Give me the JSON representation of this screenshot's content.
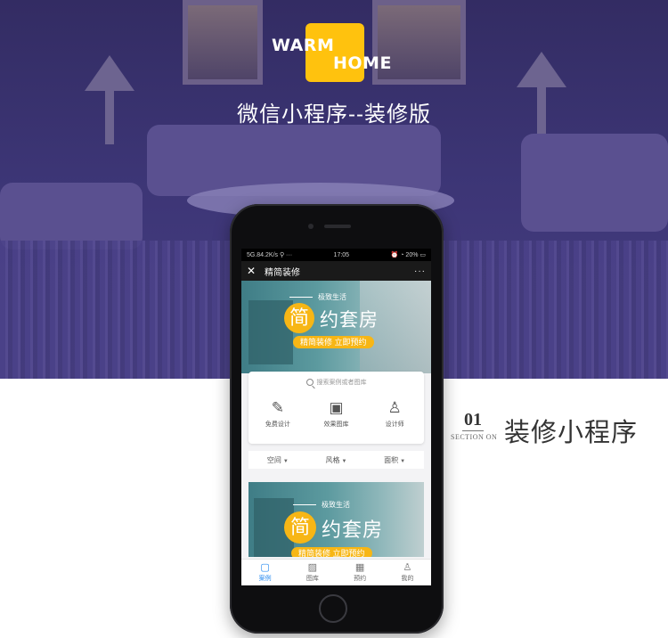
{
  "logo": {
    "word1": "WARM",
    "word2": "HOME"
  },
  "hero_title": "微信小程序--装修版",
  "section": {
    "number": "01",
    "label": "SECTION ON",
    "title": "装修小程序"
  },
  "phone": {
    "status": {
      "left": "5G.84.2K/s ⚲ ···",
      "time": "17:05",
      "right": "⏰ ◔ 20% ▭"
    },
    "nav": {
      "title": "精简装修",
      "more": "···"
    },
    "banner": {
      "tag": "极致生活",
      "big_char": "简",
      "main": "约套房",
      "cta": "精简装修 立即预约"
    },
    "search": {
      "placeholder": "搜索案例或者图库"
    },
    "features": [
      {
        "icon": "design-tools-icon",
        "glyph": "✎",
        "label": "免费设计"
      },
      {
        "icon": "gallery-icon",
        "glyph": "▣",
        "label": "效果图库"
      },
      {
        "icon": "designer-icon",
        "glyph": "♙",
        "label": "设计师"
      }
    ],
    "filters": [
      {
        "label": "空间"
      },
      {
        "label": "风格"
      },
      {
        "label": "面积"
      }
    ],
    "banner2": {
      "tag": "极致生活",
      "big_char": "简",
      "main": "约套房",
      "cta": "精简装修 立即预约"
    },
    "tabs": [
      {
        "icon": "case-icon",
        "glyph": "▢",
        "label": "案例",
        "active": true
      },
      {
        "icon": "gallery-tab-icon",
        "glyph": "▨",
        "label": "图库",
        "active": false
      },
      {
        "icon": "calendar-icon",
        "glyph": "▦",
        "label": "预约",
        "active": false
      },
      {
        "icon": "user-icon",
        "glyph": "♙",
        "label": "我的",
        "active": false
      }
    ]
  },
  "colors": {
    "accent": "#ffc20e",
    "hero_bg": "#3c3575",
    "tab_active": "#2b8cf0"
  }
}
